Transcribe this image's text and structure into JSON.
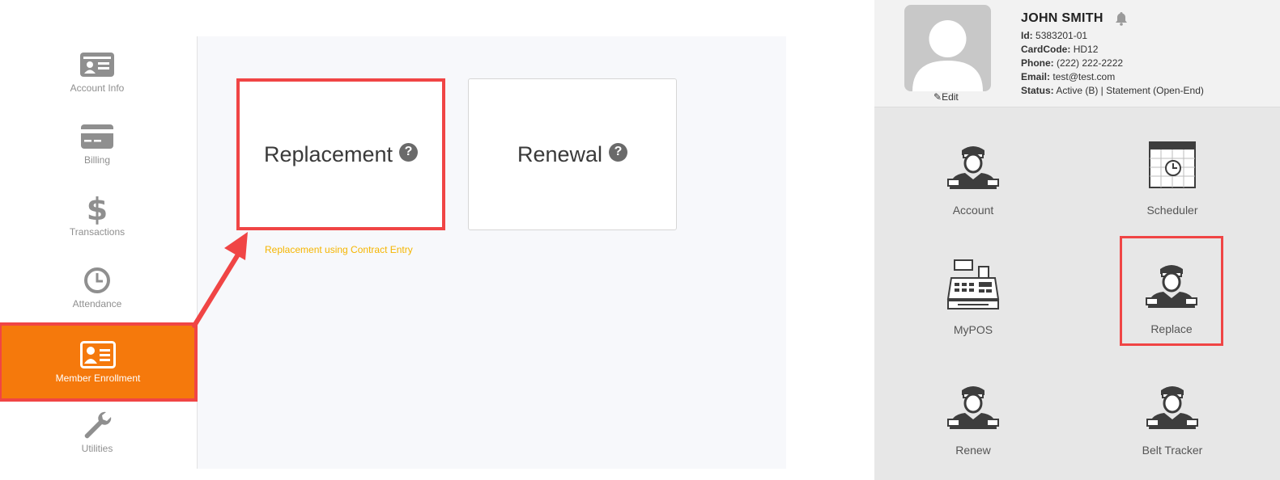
{
  "sidebar": {
    "items": [
      {
        "label": "Account Info",
        "icon": "id-card-icon"
      },
      {
        "label": "Billing",
        "icon": "credit-card-icon"
      },
      {
        "label": "Transactions",
        "icon": "dollar-icon"
      },
      {
        "label": "Attendance",
        "icon": "clock-icon"
      },
      {
        "label": "Member Enrollment",
        "icon": "id-card-icon",
        "active": true
      },
      {
        "label": "Utilities",
        "icon": "wrench-icon"
      }
    ]
  },
  "main": {
    "tiles": [
      {
        "label": "Replacement",
        "help": "?"
      },
      {
        "label": "Renewal",
        "help": "?"
      }
    ],
    "hint": "Replacement using Contract Entry"
  },
  "profile": {
    "name": "JOHN SMITH",
    "edit_label": "Edit",
    "fields": [
      {
        "key": "Id:",
        "value": "5383201-01"
      },
      {
        "key": "CardCode:",
        "value": "HD12"
      },
      {
        "key": "Phone:",
        "value": "(222) 222-2222"
      },
      {
        "key": "Email:",
        "value": "test@test.com"
      },
      {
        "key": "Status:",
        "value": "Active (B) | Statement (Open-End)"
      }
    ]
  },
  "apps": [
    {
      "label": "Account",
      "icon": "person-icon"
    },
    {
      "label": "Scheduler",
      "icon": "calendar-icon"
    },
    {
      "label": "MyPOS",
      "icon": "cash-register-icon"
    },
    {
      "label": "Replace",
      "icon": "person-icon",
      "selected": true
    },
    {
      "label": "Renew",
      "icon": "person-icon"
    },
    {
      "label": "Belt Tracker",
      "icon": "person-icon"
    }
  ],
  "colors": {
    "accent": "#f5790c",
    "highlight": "#f04545",
    "hint": "#f5b500"
  }
}
